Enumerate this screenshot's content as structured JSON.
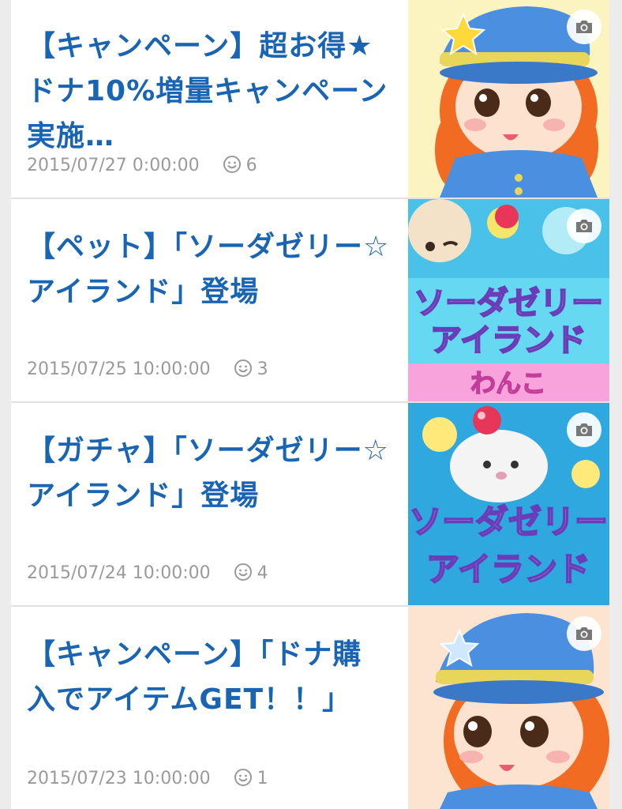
{
  "entries": [
    {
      "title": "【キャンペーン】超お得★ドナ10%増量キャンペーン実施…",
      "date": "2015/07/27 0:00:00",
      "comments": "6",
      "thumbnail_icon": "girl-captain-icon"
    },
    {
      "title": "【ペット】「ソーダゼリー☆アイランド」登場",
      "date": "2015/07/25 10:00:00",
      "comments": "3",
      "thumbnail_icon": "puppy-soda-jelly-icon",
      "thumb_line1": "ソーダゼリー",
      "thumb_line2": "アイランド",
      "thumb_band": "わんこ"
    },
    {
      "title": "【ガチャ】「ソーダゼリー☆アイランド」登場",
      "date": "2015/07/24 10:00:00",
      "comments": "4",
      "thumbnail_icon": "seal-soda-jelly-icon",
      "thumb_line1": "ソーダゼリー",
      "thumb_line2": "アイランド"
    },
    {
      "title": "【キャンペーン】「ドナ購入でアイテムGET！！」",
      "date": "2015/07/23 10:00:00",
      "comments": "1",
      "thumbnail_icon": "girl-captain-icon"
    }
  ],
  "colors": {
    "title": "#1a64b4",
    "meta": "#9a9a9a",
    "background": "#ececec"
  }
}
